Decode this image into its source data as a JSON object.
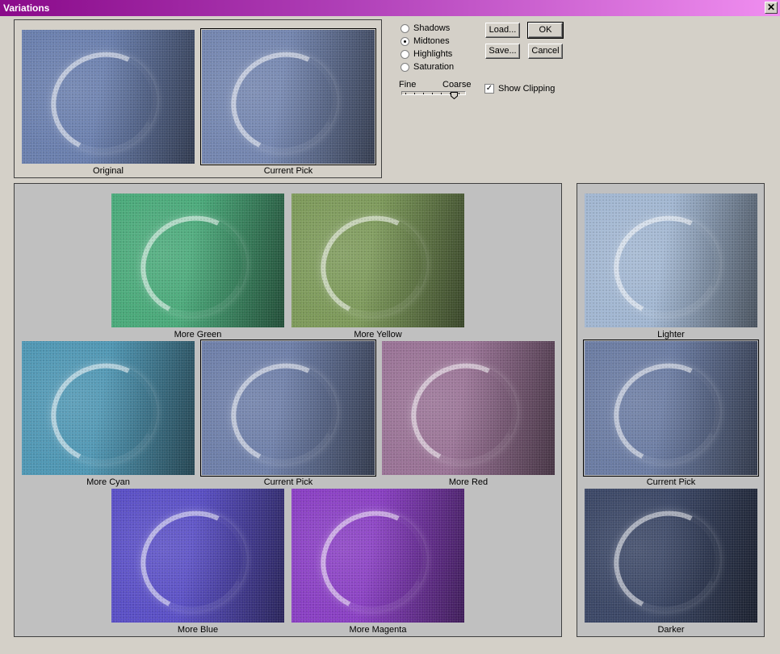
{
  "window": {
    "title": "Variations",
    "close_glyph": "✕"
  },
  "top_previews": {
    "original": {
      "label": "Original",
      "tint": "#6a7fae"
    },
    "current_pick": {
      "label": "Current Pick",
      "tint": "#7486b0"
    }
  },
  "modes": [
    {
      "label": "Shadows",
      "selected": false
    },
    {
      "label": "Midtones",
      "selected": true
    },
    {
      "label": "Highlights",
      "selected": false
    },
    {
      "label": "Saturation",
      "selected": false
    }
  ],
  "buttons": {
    "load": "Load...",
    "ok": "OK",
    "save": "Save...",
    "cancel": "Cancel"
  },
  "slider": {
    "fine_label": "Fine",
    "coarse_label": "Coarse",
    "tick_count": 7,
    "value_step": 5
  },
  "show_clipping": {
    "label": "Show Clipping",
    "checked": true,
    "check_glyph": "✓"
  },
  "color_grid": {
    "more_green": {
      "label": "More Green",
      "tint": "#4aaa7a"
    },
    "more_yellow": {
      "label": "More Yellow",
      "tint": "#7d9a5a"
    },
    "more_cyan": {
      "label": "More Cyan",
      "tint": "#4f97b4"
    },
    "current_pick": {
      "label": "Current Pick",
      "tint": "#6e7fa9"
    },
    "more_red": {
      "label": "More Red",
      "tint": "#9a7396"
    },
    "more_blue": {
      "label": "More Blue",
      "tint": "#5a4fc6"
    },
    "more_magenta": {
      "label": "More Magenta",
      "tint": "#8a3fc4"
    }
  },
  "lightness": {
    "lighter": {
      "label": "Lighter",
      "tint": "#a2b7d2"
    },
    "current_pick": {
      "label": "Current Pick",
      "tint": "#6b7ca3"
    },
    "darker": {
      "label": "Darker",
      "tint": "#3b4766"
    }
  }
}
